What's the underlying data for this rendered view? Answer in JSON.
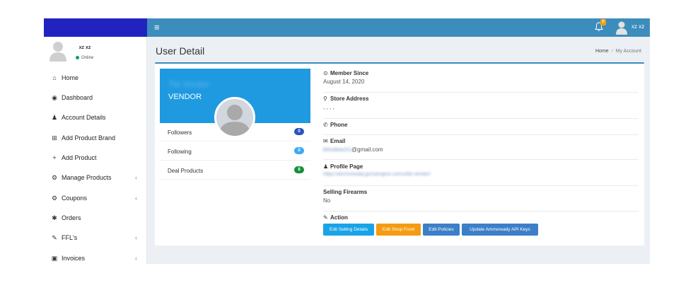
{
  "topbar": {
    "menu_glyph": "≡",
    "bell_glyph": "♫",
    "notification_count": "8",
    "username": "xz xz"
  },
  "sidebar": {
    "user": {
      "name": "xz xz",
      "status": "Online"
    },
    "items": [
      {
        "icon": "home-icon",
        "glyph": "⌂",
        "label": "Home",
        "has_children": false
      },
      {
        "icon": "dashboard-icon",
        "glyph": "◉",
        "label": "Dashboard",
        "has_children": false
      },
      {
        "icon": "user-icon",
        "glyph": "♟",
        "label": "Account Details",
        "has_children": false
      },
      {
        "icon": "cart-icon",
        "glyph": "⊞",
        "label": "Add Product Brand",
        "has_children": false
      },
      {
        "icon": "plus-icon",
        "glyph": "+",
        "label": "Add Product",
        "has_children": false
      },
      {
        "icon": "cogs-icon",
        "glyph": "⚙",
        "label": "Manage Products",
        "has_children": true
      },
      {
        "icon": "cogs-icon",
        "glyph": "⚙",
        "label": "Coupons",
        "has_children": true
      },
      {
        "icon": "orders-icon",
        "glyph": "✱",
        "label": "Orders",
        "has_children": false
      },
      {
        "icon": "wrench-icon",
        "glyph": "✎",
        "label": "FFL's",
        "has_children": true
      },
      {
        "icon": "invoice-icon",
        "glyph": "▣",
        "label": "Invoices",
        "has_children": true
      }
    ],
    "chevron": "‹"
  },
  "page": {
    "title": "User Detail",
    "breadcrumb": [
      "Home",
      "My Account"
    ],
    "breadcrumb_separator": ">"
  },
  "profile": {
    "vendor_name": "Tbi Vendor",
    "role": "VENDOR",
    "stats": [
      {
        "label": "Followers",
        "value": "0",
        "color": "#2a55b8"
      },
      {
        "label": "Following",
        "value": "0",
        "color": "#3fa9f5"
      },
      {
        "label": "Deal Products",
        "value": "8",
        "color": "#1a8f3a"
      }
    ]
  },
  "details": {
    "member_since": {
      "label": "Member Since",
      "value": "August 14, 2020"
    },
    "store_address": {
      "label": "Store Address",
      "value": ", , , ,"
    },
    "phone": {
      "label": "Phone",
      "value": ""
    },
    "email": {
      "label": "Email",
      "value_hidden": "klmnbwch1",
      "value_visible": "@gmail.com"
    },
    "profile_page": {
      "label": "Profile Page",
      "value": "https://ammoready.gunsengine.com/u/tbi-vendor/"
    },
    "selling_firearms": {
      "label": "Selling Firearms",
      "value": "No"
    },
    "action": {
      "label": "Action"
    }
  },
  "actions": [
    {
      "label": "Edit Selling Details",
      "color": "#1aa3e6"
    },
    {
      "label": "Edit Shop Front",
      "color": "#f39c12"
    },
    {
      "label": "Edit Policies",
      "color": "#3c7fc8"
    },
    {
      "label": "Update Ammoready API Keys",
      "color": "#3c7fc8"
    }
  ],
  "colors": {
    "header": "#3c8dbc",
    "logo_box": "#2222c0",
    "content_bg": "#ecf0f5",
    "widget_header": "#1f9ae0"
  }
}
